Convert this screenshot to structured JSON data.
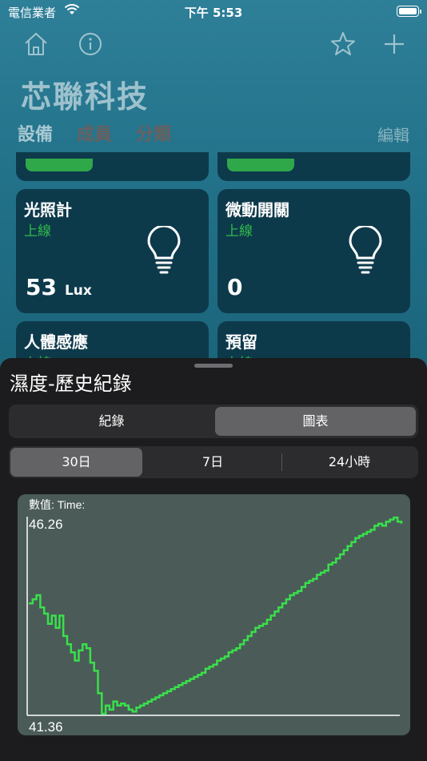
{
  "status_bar": {
    "carrier": "電信業者",
    "time": "下午 5:53"
  },
  "header": {
    "title": "芯聯科技",
    "tabs": [
      "設備",
      "成員",
      "分類"
    ],
    "edit_label": "編輯",
    "icons": [
      "home-icon",
      "info-icon",
      "star-icon",
      "plus-icon"
    ]
  },
  "devices": [
    {
      "name": "光照計",
      "status": "上線",
      "value": "53",
      "unit": "Lux"
    },
    {
      "name": "微動開關",
      "status": "上線",
      "value": "0",
      "unit": ""
    },
    {
      "name": "人體感應",
      "status": "上線"
    },
    {
      "name": "預留",
      "status": "上線"
    }
  ],
  "sheet": {
    "title": "濕度-歷史紀錄",
    "view_segments": [
      "紀錄",
      "圖表"
    ],
    "selected_view": "圖表",
    "range_segments": [
      "30日",
      "7日",
      "24小時"
    ],
    "selected_range": "30日"
  },
  "colors": {
    "online_green": "#31b94a",
    "line_green": "#39e04a",
    "chart_bg": "#4a5b58",
    "sheet_bg": "#1c1c1e"
  },
  "chart_data": {
    "type": "line",
    "title": "數值: Time:",
    "ymax_label": "46.26",
    "ymin_label": "41.36",
    "ylim": [
      41.36,
      46.26
    ],
    "series": [
      {
        "values": [
          44.1,
          44.2,
          44.3,
          44.0,
          43.85,
          43.6,
          43.8,
          43.5,
          43.8,
          43.3,
          43.1,
          42.9,
          42.7,
          42.95,
          43.1,
          43.0,
          42.65,
          42.45,
          41.9,
          41.4,
          41.6,
          41.5,
          41.7,
          41.6,
          41.65,
          41.6,
          41.5,
          41.45,
          41.55,
          41.6,
          41.65,
          41.7,
          41.75,
          41.8,
          41.85,
          41.9,
          41.95,
          42.0,
          42.05,
          42.1,
          42.15,
          42.2,
          42.25,
          42.3,
          42.35,
          42.4,
          42.5,
          42.55,
          42.6,
          42.7,
          42.75,
          42.8,
          42.9,
          42.95,
          43.0,
          43.1,
          43.2,
          43.3,
          43.4,
          43.5,
          43.55,
          43.6,
          43.7,
          43.8,
          43.9,
          44.0,
          44.1,
          44.2,
          44.3,
          44.35,
          44.4,
          44.5,
          44.6,
          44.65,
          44.7,
          44.8,
          44.85,
          44.9,
          45.05,
          45.1,
          45.2,
          45.3,
          45.4,
          45.5,
          45.6,
          45.7,
          45.75,
          45.8,
          45.85,
          45.9,
          46.0,
          46.05,
          46.0,
          46.1,
          46.15,
          46.2,
          46.1,
          46.05
        ]
      }
    ]
  }
}
